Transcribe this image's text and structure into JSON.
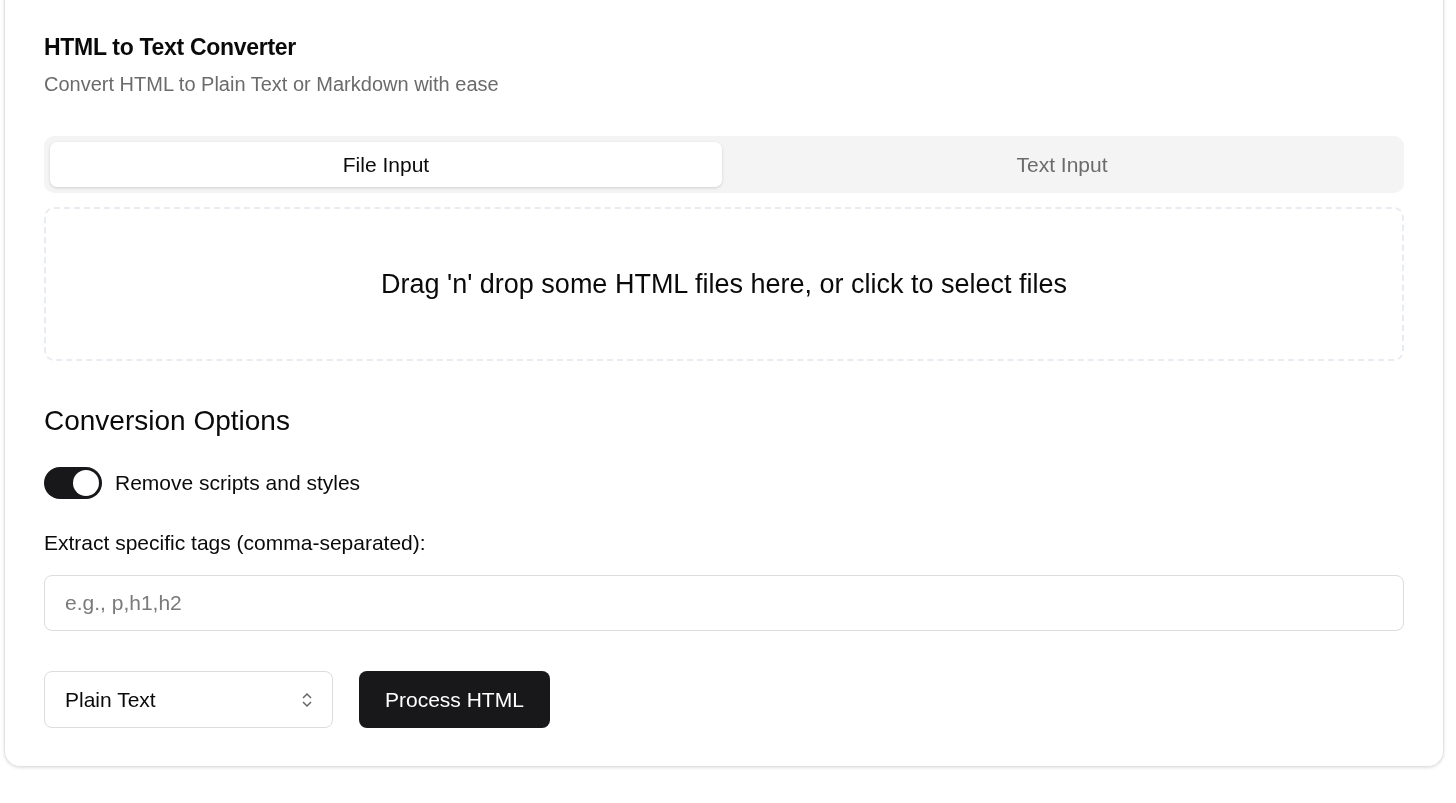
{
  "card": {
    "title": "HTML to Text Converter",
    "subtitle": "Convert HTML to Plain Text or Markdown with ease"
  },
  "tabs": [
    {
      "label": "File Input",
      "selected": true
    },
    {
      "label": "Text Input",
      "selected": false
    }
  ],
  "dropzone": {
    "text": "Drag 'n' drop some HTML files here, or click to select files"
  },
  "options": {
    "heading": "Conversion Options",
    "toggle": {
      "label": "Remove scripts and styles",
      "on": true
    },
    "tags_label": "Extract specific tags (comma-separated):",
    "tags_field": {
      "placeholder": "e.g., p,h1,h2"
    }
  },
  "format_select": {
    "value": "Plain Text"
  },
  "process_button": {
    "label": "Process HTML"
  }
}
